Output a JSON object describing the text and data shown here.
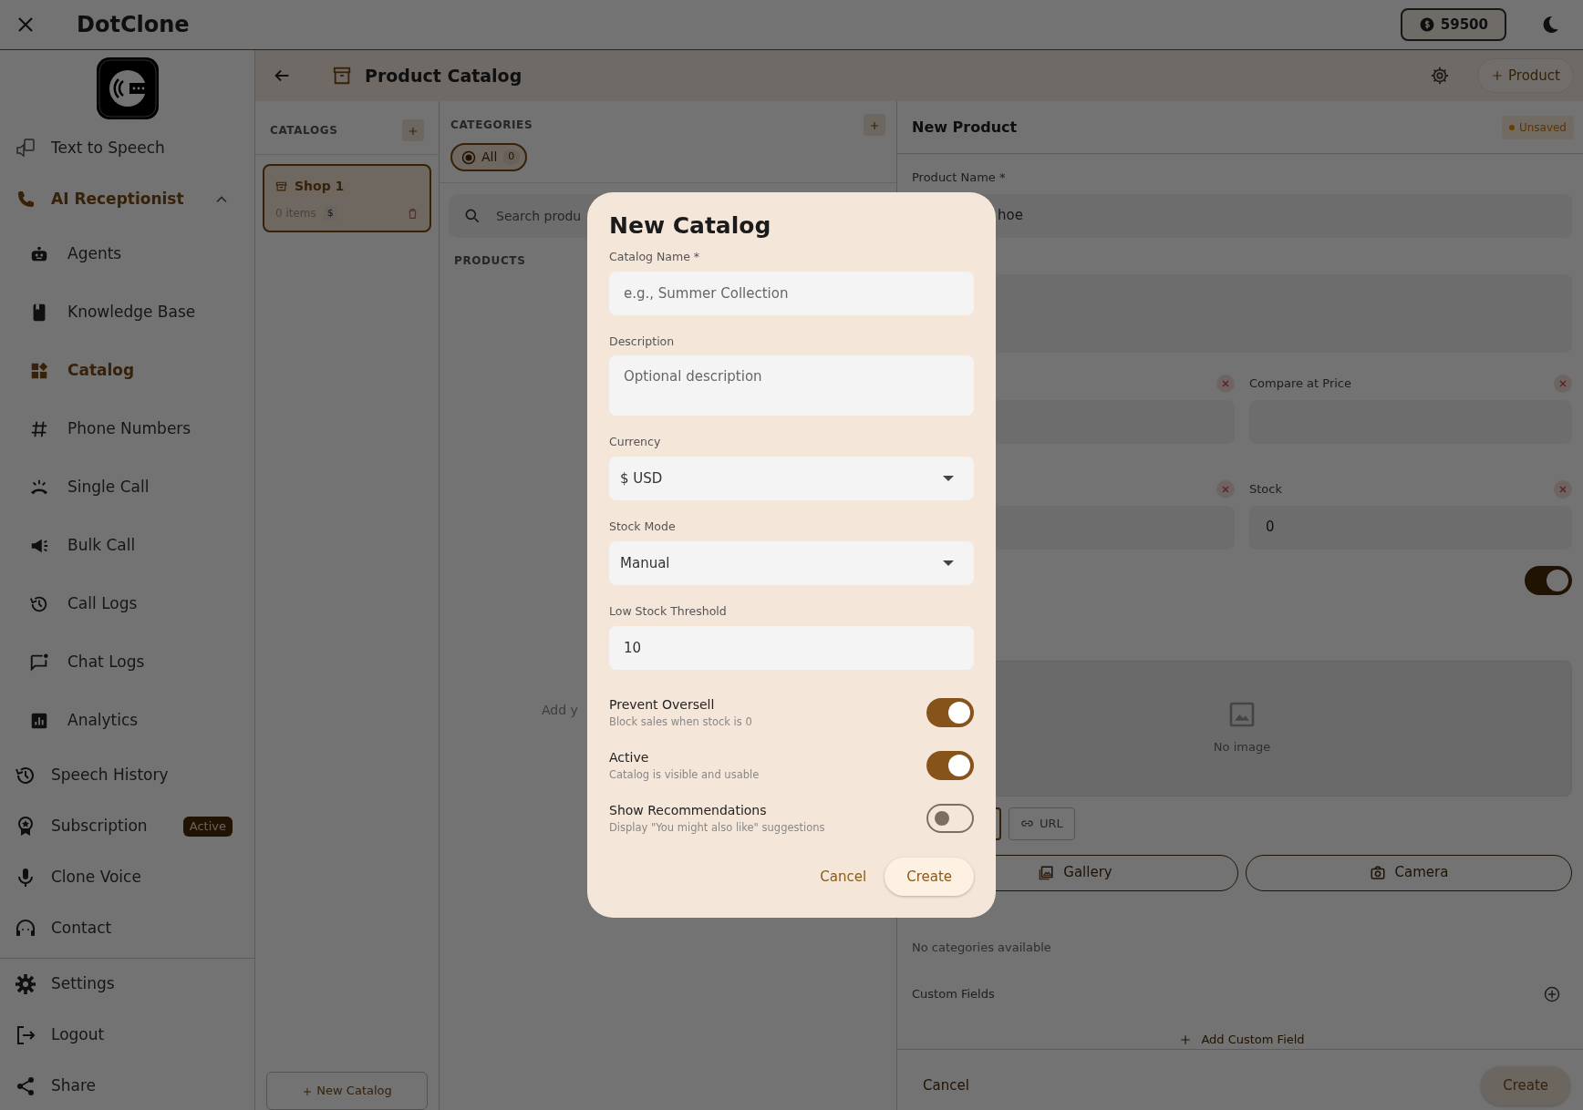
{
  "app": {
    "title": "DotClone",
    "credits": "59500"
  },
  "sidebar": {
    "items": [
      {
        "label": "Text to Speech",
        "kind": "item",
        "selected": false
      },
      {
        "label": "AI Receptionist",
        "kind": "group",
        "selected": true,
        "expanded": true,
        "children": [
          {
            "label": "Agents",
            "selected": false
          },
          {
            "label": "Knowledge Base",
            "selected": false
          },
          {
            "label": "Catalog",
            "selected": true
          },
          {
            "label": "Phone Numbers",
            "selected": false
          },
          {
            "label": "Single Call",
            "selected": false
          },
          {
            "label": "Bulk Call",
            "selected": false
          },
          {
            "label": "Call Logs",
            "selected": false
          },
          {
            "label": "Chat Logs",
            "selected": false
          },
          {
            "label": "Analytics",
            "selected": false
          }
        ]
      },
      {
        "label": "Speech History",
        "kind": "item",
        "selected": false
      },
      {
        "label": "Subscription",
        "kind": "item",
        "selected": false,
        "badge": "Active"
      },
      {
        "label": "Clone Voice",
        "kind": "item",
        "selected": false
      },
      {
        "label": "Contact",
        "kind": "item",
        "selected": false
      }
    ],
    "footer_items": [
      {
        "label": "Settings"
      },
      {
        "label": "Logout"
      },
      {
        "label": "Share"
      }
    ]
  },
  "toolbar": {
    "title": "Product Catalog",
    "action": "Product"
  },
  "catalogs": {
    "heading": "CATALOGS",
    "items": [
      {
        "name": "Shop 1",
        "count": "0 items",
        "currency": "$",
        "selected": true
      }
    ],
    "new_button": "New Catalog"
  },
  "categories": {
    "heading": "CATEGORIES",
    "chips": [
      {
        "label": "All",
        "count": "0",
        "selected": true
      }
    ],
    "search_placeholder": "Search produ",
    "products_heading": "PRODUCTS",
    "empty_text": "Add y"
  },
  "product": {
    "title": "New Product",
    "status": "Unsaved",
    "name_label": "Product Name *",
    "name_value": "hoe",
    "price_row": [
      {
        "clearable": true
      },
      {
        "label": "Compare at Price",
        "clearable": true
      }
    ],
    "stock_row": [
      {
        "clearable": true
      },
      {
        "label": "Stock",
        "value": "0",
        "clearable": true
      }
    ],
    "active_toggle": {
      "on": true
    },
    "image_placeholder": "No image",
    "image_sources": [
      {
        "selected": true
      },
      {
        "label": "URL",
        "selected": false
      }
    ],
    "capture_buttons": [
      "Gallery",
      "Camera"
    ],
    "categories_note": "No categories available",
    "custom_fields_label": "Custom Fields",
    "add_custom_field": "Add Custom Field",
    "buttons": [
      {
        "label": "Cancel",
        "kind": "text"
      },
      {
        "label": "Create",
        "kind": "filled"
      }
    ]
  },
  "dialog": {
    "title": "New Catalog",
    "fields": [
      {
        "label": "Catalog Name *",
        "kind": "text",
        "placeholder": "e.g., Summer Collection"
      },
      {
        "label": "Description",
        "kind": "textarea",
        "placeholder": "Optional description"
      },
      {
        "label": "Currency",
        "kind": "select",
        "value": "$ USD"
      },
      {
        "label": "Stock Mode",
        "kind": "select",
        "value": "Manual"
      },
      {
        "label": "Low Stock Threshold",
        "kind": "text",
        "value": "10"
      }
    ],
    "toggles": [
      {
        "label": "Prevent Oversell",
        "description": "Block sales when stock is 0",
        "on": true
      },
      {
        "label": "Active",
        "description": "Catalog is visible and usable",
        "on": true
      },
      {
        "label": "Show Recommendations",
        "description": "Display \"You might also like\" suggestions",
        "on": false
      }
    ],
    "buttons": [
      {
        "label": "Cancel",
        "kind": "text"
      },
      {
        "label": "Create",
        "kind": "filled"
      }
    ]
  }
}
